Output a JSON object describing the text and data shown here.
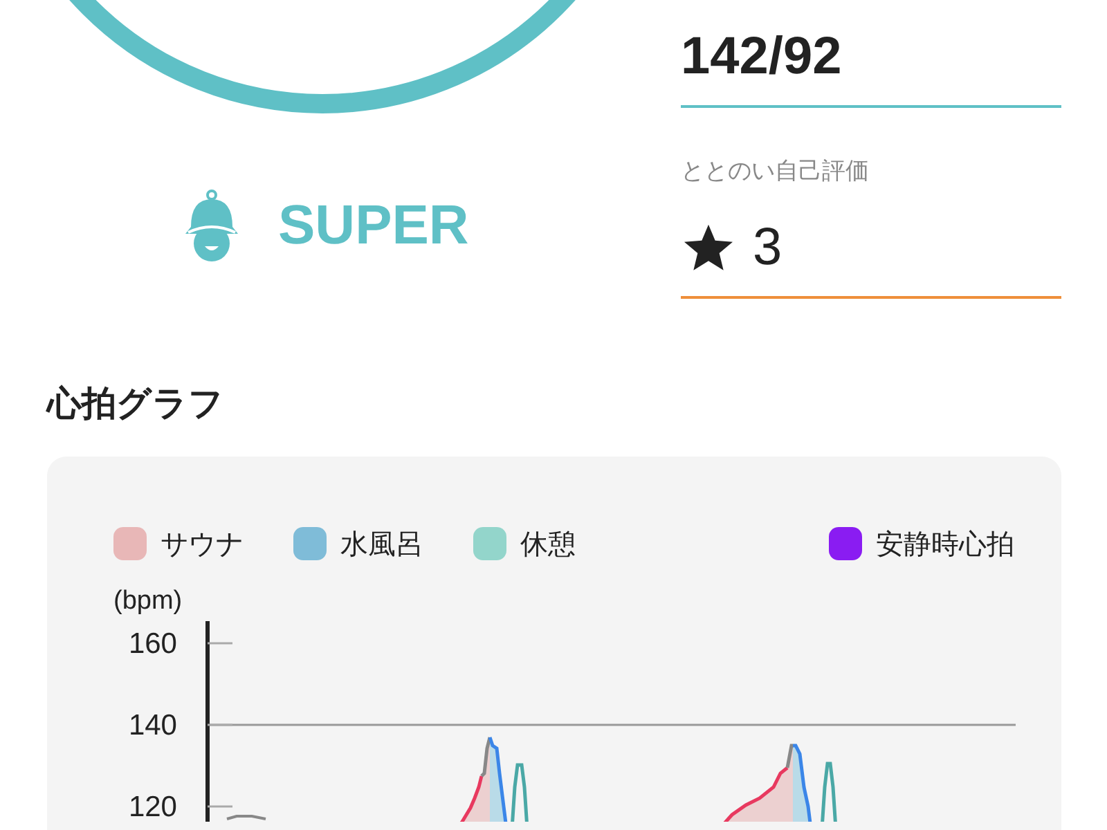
{
  "summary": {
    "level_label": "SUPER",
    "blood_pressure": "142/92",
    "rating_label": "ととのい自己評価",
    "rating": "3"
  },
  "heart_graph": {
    "title": "心拍グラフ",
    "legend": [
      {
        "label": "サウナ",
        "color": "#e8b7b7"
      },
      {
        "label": "水風呂",
        "color": "#7fbcd8"
      },
      {
        "label": "休憩",
        "color": "#93d5cb"
      },
      {
        "label": "安静時心拍",
        "color": "#8a1cf2"
      }
    ],
    "unit": "(bpm)",
    "y_ticks": [
      "160",
      "140",
      "120"
    ]
  }
}
